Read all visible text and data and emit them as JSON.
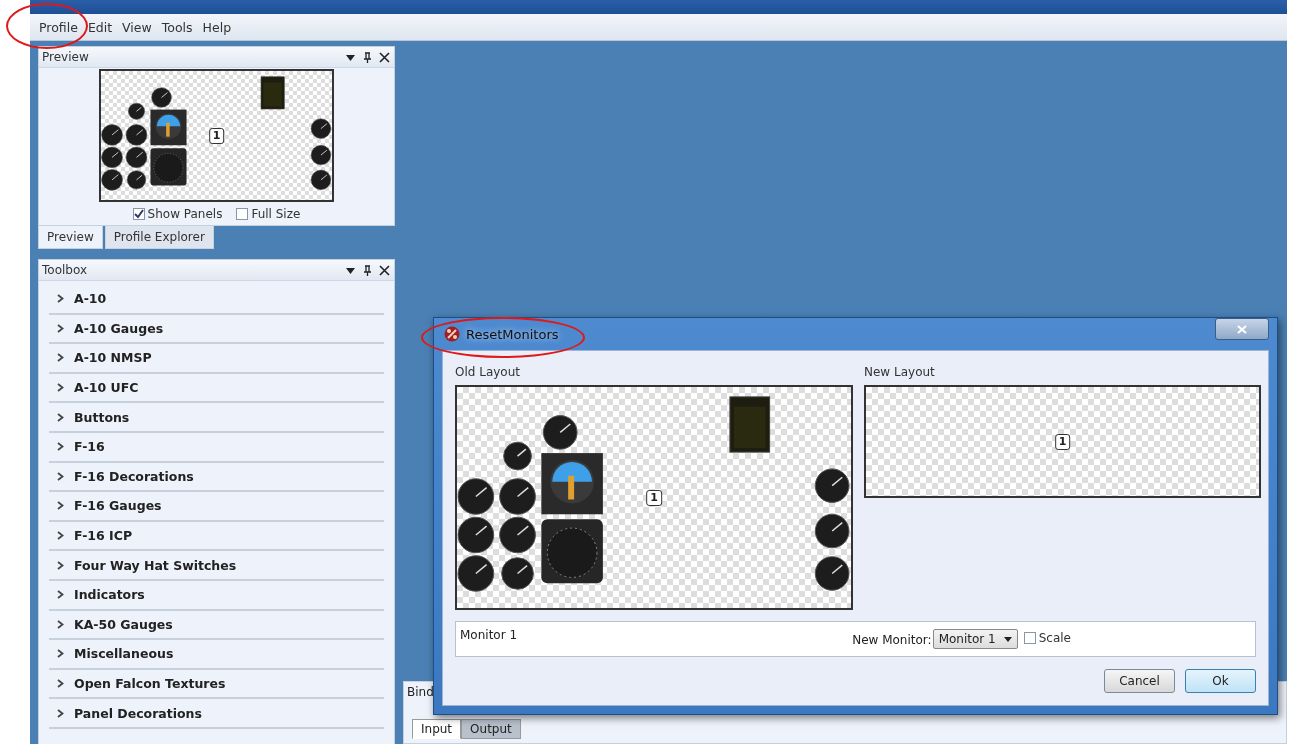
{
  "menu": [
    "Profile",
    "Edit",
    "View",
    "Tools",
    "Help"
  ],
  "preview_panel": {
    "title": "Preview",
    "badge": "1",
    "show_panels": {
      "label": "Show Panels",
      "checked": true
    },
    "full_size": {
      "label": "Full Size",
      "checked": false
    }
  },
  "left_tabs": [
    {
      "label": "Preview",
      "selected": true
    },
    {
      "label": "Profile Explorer",
      "selected": false
    }
  ],
  "toolbox": {
    "title": "Toolbox",
    "items": [
      {
        "label": "A-10",
        "expanded": false
      },
      {
        "label": "A-10 Gauges",
        "expanded": false
      },
      {
        "label": "A-10 NMSP",
        "expanded": false
      },
      {
        "label": "A-10 UFC",
        "expanded": false
      },
      {
        "label": "Buttons",
        "expanded": false
      },
      {
        "label": "F-16",
        "expanded": false
      },
      {
        "label": "F-16 Decorations",
        "expanded": false
      },
      {
        "label": "F-16 Gauges",
        "expanded": false
      },
      {
        "label": "F-16 ICP",
        "expanded": false
      },
      {
        "label": "Four Way Hat Switches",
        "expanded": false
      },
      {
        "label": "Indicators",
        "expanded": false
      },
      {
        "label": "KA-50 Gauges",
        "expanded": false
      },
      {
        "label": "Miscellaneous",
        "expanded": false
      },
      {
        "label": "Open Falcon Textures",
        "expanded": false
      },
      {
        "label": "Panel Decorations",
        "expanded": false
      }
    ]
  },
  "bindings_panel": {
    "title": "Bind",
    "tabs": [
      {
        "label": "Input",
        "selected": true
      },
      {
        "label": "Output",
        "selected": false
      }
    ]
  },
  "dialog": {
    "title": "ResetMonitors",
    "old_layout": {
      "label": "Old Layout",
      "badge": "1"
    },
    "new_layout": {
      "label": "New Layout",
      "badge": "1"
    },
    "monitor_row": {
      "name": "Monitor 1",
      "new_monitor_label": "New Monitor:",
      "new_monitor_value": "Monitor 1",
      "scale": {
        "label": "Scale",
        "checked": false
      }
    },
    "buttons": [
      "Cancel",
      "Ok"
    ]
  }
}
